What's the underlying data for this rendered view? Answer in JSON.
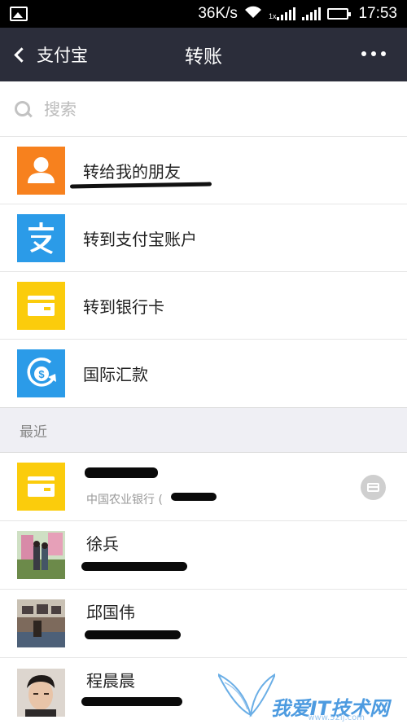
{
  "status_bar": {
    "network_speed": "36K/s",
    "network_type": "1x",
    "time": "17:53",
    "icons": [
      "gallery-icon",
      "wifi-icon",
      "signal-icon",
      "battery-icon"
    ]
  },
  "nav": {
    "back_label": "支付宝",
    "title": "转账",
    "more_icon": "more-dots-icon"
  },
  "search": {
    "placeholder": "搜索",
    "icon": "search-icon"
  },
  "menu": [
    {
      "label": "转给我的朋友",
      "icon": "person-icon",
      "color": "#f7811e"
    },
    {
      "label": "转到支付宝账户",
      "icon": "alipay-icon",
      "color": "#2b9be8"
    },
    {
      "label": "转到银行卡",
      "icon": "bank-card-icon",
      "color": "#fbcc0c"
    },
    {
      "label": "国际汇款",
      "icon": "international-remit-icon",
      "color": "#2b9be8"
    }
  ],
  "recent_section": {
    "title": "最近"
  },
  "recent": [
    {
      "name": "",
      "sub": "中国农业银行 (",
      "icon": "bank-card-icon",
      "action_icon": "bank-card-action-icon"
    },
    {
      "name": "徐兵",
      "sub": "",
      "icon": "avatar-photo"
    },
    {
      "name": "邱国伟",
      "sub": "",
      "icon": "avatar-photo"
    },
    {
      "name": "程晨晨",
      "sub": "",
      "icon": "avatar-photo"
    }
  ],
  "watermark": {
    "text": "我爱IT技术网",
    "url": "www.52ij.com"
  },
  "colors": {
    "nav_bg": "#2b2d3a",
    "section_bg": "#efeff4",
    "orange": "#f7811e",
    "blue": "#2b9be8",
    "yellow": "#fbcc0c",
    "battery": "#3ddc3d"
  }
}
